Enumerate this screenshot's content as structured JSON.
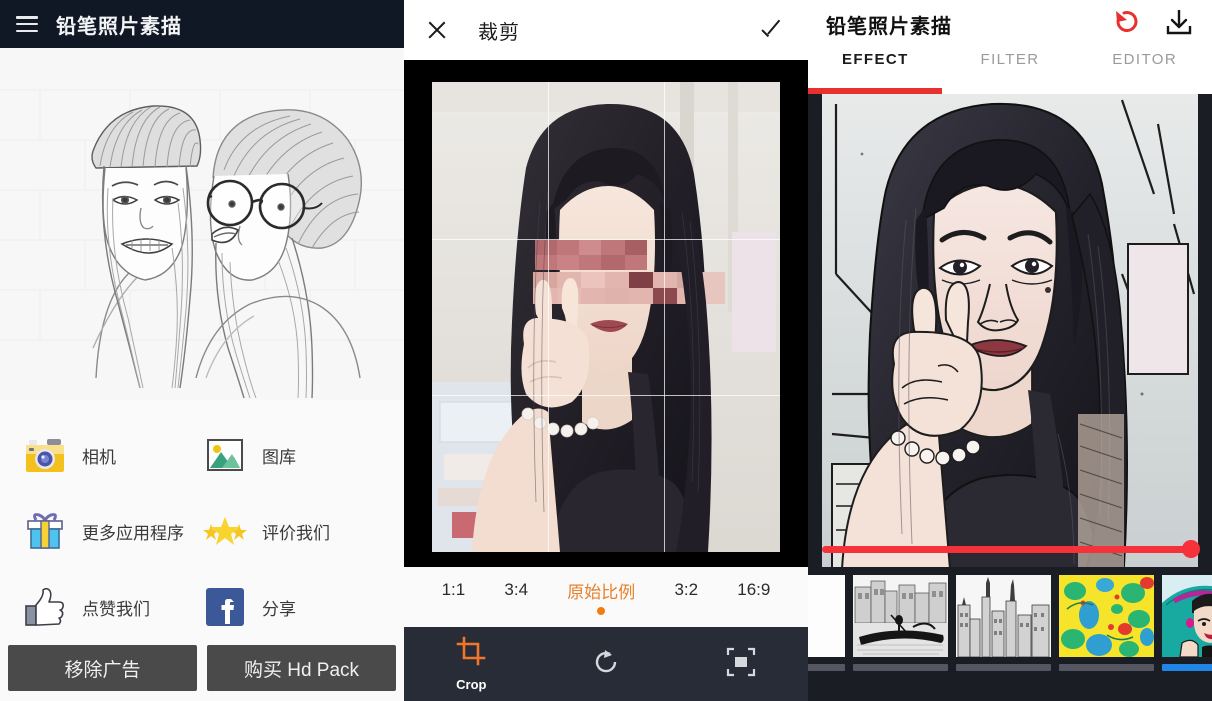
{
  "app": {
    "name": "铅笔照片素描",
    "accent_orange": "#f07d12",
    "accent_red": "#e8312f",
    "accent_blue": "#1f86e8",
    "dark_bar": "#101826",
    "tool_bar": "#282c37"
  },
  "home": {
    "menu_icon": "hamburger-menu-icon",
    "title": "铅笔照片素描",
    "preview_alt": "pencil-sketch-of-two-girls",
    "tiles": [
      {
        "label": "相机",
        "icon": "camera-icon"
      },
      {
        "label": "图库",
        "icon": "gallery-icon"
      },
      {
        "label": "更多应用程序",
        "icon": "gift-icon"
      },
      {
        "label": "评价我们",
        "icon": "stars-icon"
      },
      {
        "label": "点赞我们",
        "icon": "thumbs-up-icon"
      },
      {
        "label": "分享",
        "icon": "facebook-icon"
      }
    ],
    "buttons": [
      {
        "label": "移除广告"
      },
      {
        "label": "购买 Hd Pack"
      }
    ]
  },
  "crop": {
    "close_icon": "close-icon",
    "title": "裁剪",
    "confirm_icon": "check-icon",
    "photo_alt": "selfie-photo-with-censored-face",
    "ratios": [
      {
        "label": "1:1",
        "selected": false
      },
      {
        "label": "3:4",
        "selected": false
      },
      {
        "label": "原始比例",
        "selected": true
      },
      {
        "label": "3:2",
        "selected": false
      },
      {
        "label": "16:9",
        "selected": false
      }
    ],
    "tools": [
      {
        "label": "Crop",
        "icon": "crop-icon",
        "active": true
      },
      {
        "label": "",
        "icon": "rotate-icon",
        "active": false
      },
      {
        "label": "",
        "icon": "fit-frame-icon",
        "active": false
      }
    ]
  },
  "effect": {
    "title": "铅笔照片素描",
    "undo_icon": "undo-icon",
    "save_icon": "download-icon",
    "tabs": [
      {
        "label": "EFFECT",
        "selected": true
      },
      {
        "label": "FILTER",
        "selected": false
      },
      {
        "label": "EDITOR",
        "selected": false
      }
    ],
    "preview_alt": "comic-style-filtered-portrait",
    "slider": {
      "name": "effect-intensity-slider",
      "value": 100
    },
    "thumbnails": [
      {
        "name": "thumb-blank",
        "alt": "blank-white",
        "selected": false
      },
      {
        "name": "thumb-venice",
        "alt": "venice-gondola-sketch",
        "selected": false
      },
      {
        "name": "thumb-city",
        "alt": "city-skyline-sketch",
        "selected": false
      },
      {
        "name": "thumb-watercolor",
        "alt": "colorful-watercolor-blobs",
        "selected": false
      },
      {
        "name": "thumb-popart",
        "alt": "pop-art-woman-with-hat",
        "selected": true
      }
    ]
  }
}
